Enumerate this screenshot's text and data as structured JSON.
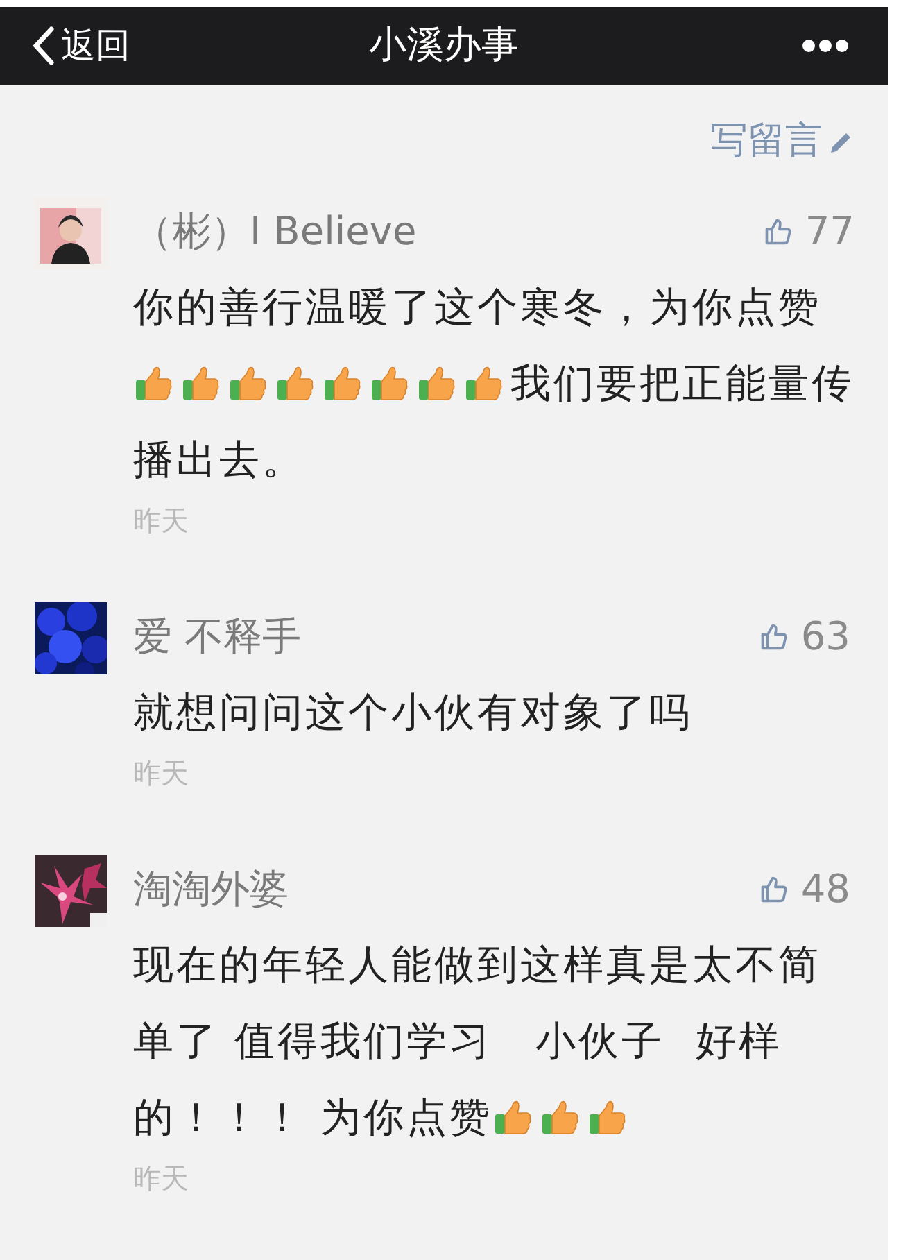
{
  "nav_bar": {
    "back_label": "返回",
    "title": "小溪办事"
  },
  "write_comment": {
    "label": "写留言"
  },
  "comments": [
    {
      "author": "（彬）I Believe",
      "likes": "77",
      "time": "昨天",
      "content": [
        {
          "kind": "text",
          "text": "你的善行温暖了这个寒冬，为你点赞"
        },
        {
          "kind": "break"
        },
        {
          "kind": "thumb"
        },
        {
          "kind": "thumb"
        },
        {
          "kind": "thumb"
        },
        {
          "kind": "thumb"
        },
        {
          "kind": "thumb"
        },
        {
          "kind": "thumb"
        },
        {
          "kind": "thumb"
        },
        {
          "kind": "thumb"
        },
        {
          "kind": "text",
          "text": "我们要把正能量传"
        },
        {
          "kind": "break"
        },
        {
          "kind": "text",
          "text": "播出去。"
        }
      ]
    },
    {
      "author": "爱 不释手",
      "likes": "63",
      "time": "昨天",
      "content": [
        {
          "kind": "text",
          "text": "就想问问这个小伙有对象了吗"
        }
      ]
    },
    {
      "author": "淘淘外婆",
      "likes": "48",
      "time": "昨天",
      "content": [
        {
          "kind": "text",
          "text": "现在的年轻人能做到这样真是太不简"
        },
        {
          "kind": "break"
        },
        {
          "kind": "text",
          "text": "单了 值得我们学习　小伙子  好样"
        },
        {
          "kind": "break"
        },
        {
          "kind": "text",
          "text": "的！！！ 为你点赞"
        },
        {
          "kind": "thumb"
        },
        {
          "kind": "thumb"
        },
        {
          "kind": "thumb"
        }
      ]
    }
  ]
}
